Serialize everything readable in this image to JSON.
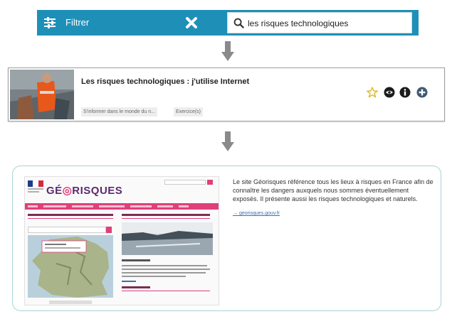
{
  "filter_bar": {
    "filter_label": "Filtrer",
    "search_value": "les risques technologiques",
    "bar_color": "#1e90b8",
    "icons": [
      "sliders-icon",
      "close-icon",
      "search-icon"
    ]
  },
  "card": {
    "title": "Les risques technologiques : j'utilise Internet",
    "tags": [
      "S'informer dans le monde du n...",
      "Exercice(s)"
    ],
    "actions": [
      "favorite-star-icon",
      "view-eye-icon",
      "info-icon",
      "add-icon"
    ]
  },
  "preview": {
    "site_name_prefix": "GÉ",
    "site_name_suffix": "RISQUES",
    "description": "Le site Géorisques référence tous les lieux à risques en France afin de connaître les dangers auxquels nous sommes éventuellement exposés. Il présente aussi les risques technologiques et naturels.",
    "link_text": "→ georisques.gouv.fr"
  }
}
